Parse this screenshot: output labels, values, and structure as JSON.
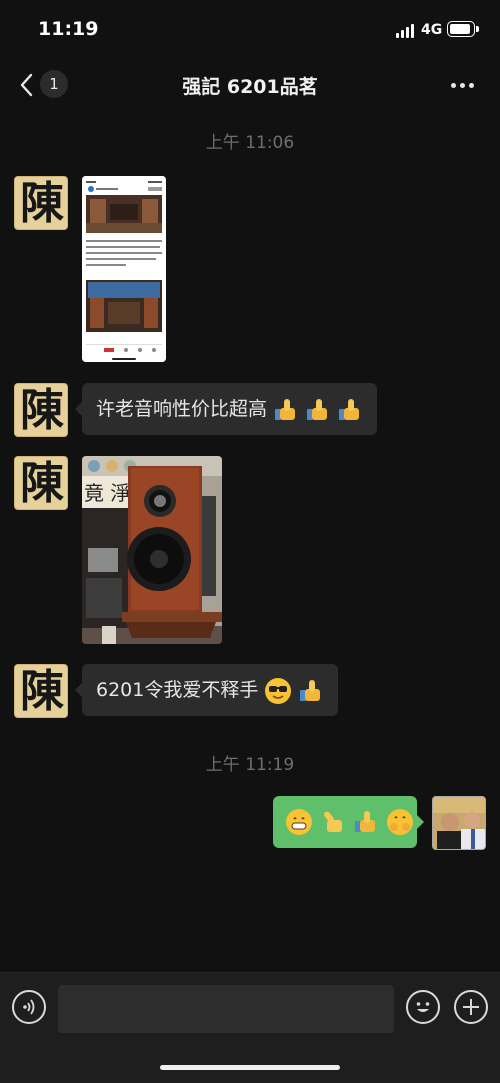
{
  "status": {
    "time": "11:19",
    "network": "4G"
  },
  "header": {
    "unread_count": "1",
    "title": "强記 6201品茗"
  },
  "messages": {
    "timestamp1": "上午 11:06",
    "sender_avatar_glyph": "陳",
    "text1": "许老音响性价比超高",
    "text2": "6201令我爱不释手",
    "timestamp2": "上午 11:19"
  },
  "screenshot_thumb": {
    "paragraph1": "许美浦展厅的工作人员正开停位动众要求切换音箱。更换相片，小箱子清晰柔顺，大偏服厚，由于比较强调解析力，个人觉得高频略微刺激些，总体看，性价比超高。",
    "footer": "写评论..."
  },
  "speaker_photo": {
    "calligraphy": "竟 淨"
  },
  "icons": {
    "back": "chevron-left-icon",
    "more": "ellipsis-icon",
    "voice": "voice-icon",
    "emoji": "emoji-icon",
    "plus": "plus-icon"
  },
  "colors": {
    "background": "#111111",
    "incoming_bubble": "#2c2c2c",
    "outgoing_bubble": "#5fbf6a"
  }
}
